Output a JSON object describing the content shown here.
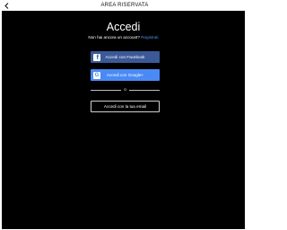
{
  "header": {
    "title": "AREA RISERVATA",
    "back_icon": "chevron-left-icon"
  },
  "login": {
    "title": "Accedi",
    "no_account_text": "Non hai ancora un account?",
    "register_link": "Registrati",
    "facebook_label": "Accedi con Facebook",
    "google_label": "Accedi con Google+",
    "divider_text": "o",
    "email_label": "Accedi con la tua email"
  },
  "colors": {
    "panel_background": "#000000",
    "facebook_blue": "#3b5998",
    "google_blue": "#4a8af4",
    "link_blue": "#4a90e2"
  }
}
